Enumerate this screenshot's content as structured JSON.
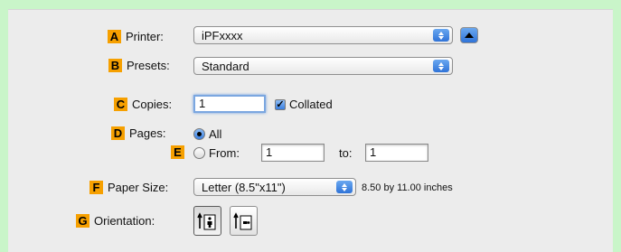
{
  "printer": {
    "badge": "A",
    "label": "Printer:",
    "value": "iPFxxxx"
  },
  "presets": {
    "badge": "B",
    "label": "Presets:",
    "value": "Standard"
  },
  "copies": {
    "badge": "C",
    "label": "Copies:",
    "value": "1",
    "collated_label": "Collated",
    "collated_checked": true
  },
  "pages": {
    "badge": "D",
    "label": "Pages:",
    "all_label": "All",
    "all_selected": true,
    "from_badge": "E",
    "from_label": "From:",
    "from_value": "1",
    "to_label": "to:",
    "to_value": "1"
  },
  "paper_size": {
    "badge": "F",
    "label": "Paper Size:",
    "value": "Letter (8.5\"x11\")",
    "dimensions": "8.50 by 11.00 inches"
  },
  "orientation": {
    "badge": "G",
    "label": "Orientation:",
    "selected": "portrait"
  },
  "colors": {
    "badge": "#f6a000",
    "background": "#c9f5c9",
    "panel": "#ececec",
    "accent": "#3a7fe0"
  }
}
